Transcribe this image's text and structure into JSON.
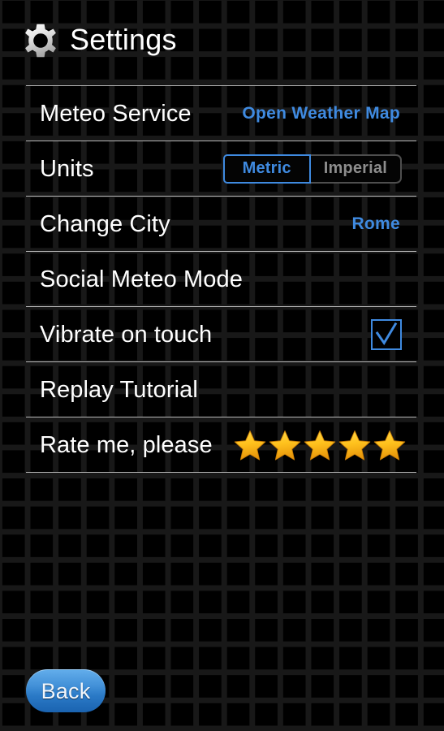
{
  "header": {
    "title": "Settings",
    "icon": "gear-icon"
  },
  "colors": {
    "background": "#000000",
    "grid_line": "#181818",
    "divider": "#b9b9b9",
    "accent_blue": "#3f8ae0",
    "text_primary": "#ffffff",
    "text_muted": "#8d8d8d",
    "star_top": "#ffd84a",
    "star_bottom": "#e8960a",
    "button_blue_top": "#63aeec",
    "button_blue_bottom": "#1a63b0"
  },
  "settings": {
    "rows": [
      {
        "label": "Meteo Service",
        "control": "value",
        "value": "Open Weather Map"
      },
      {
        "label": "Units",
        "control": "segmented",
        "options": [
          {
            "label": "Metric",
            "selected": true
          },
          {
            "label": "Imperial",
            "selected": false
          }
        ]
      },
      {
        "label": "Change City",
        "control": "value",
        "value": "Rome"
      },
      {
        "label": "Social Meteo Mode",
        "control": "none",
        "value": ""
      },
      {
        "label": "Vibrate on touch",
        "control": "checkbox",
        "checked": true
      },
      {
        "label": "Replay Tutorial",
        "control": "none",
        "value": ""
      },
      {
        "label": "Rate me, please",
        "control": "stars",
        "rating": 5,
        "max_rating": 5
      }
    ]
  },
  "footer": {
    "back_label": "Back"
  }
}
